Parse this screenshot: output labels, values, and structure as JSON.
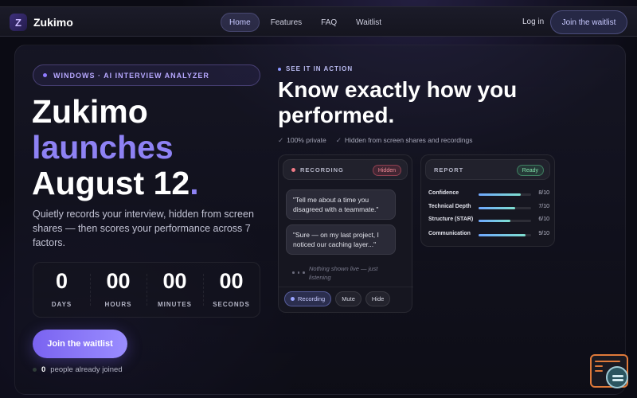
{
  "nav": {
    "logo_letter": "Z",
    "brand": "Zukimo",
    "links": [
      "Home",
      "Features",
      "FAQ",
      "Waitlist"
    ],
    "active_link": "Home",
    "login": "Log in",
    "cta": "Join the waitlist"
  },
  "hero": {
    "pill": "WINDOWS · AI INTERVIEW ANALYZER",
    "title_line1": "Zukimo",
    "title_line2": "launches",
    "title_line3": "August 12",
    "title_period": ".",
    "lede": "Quietly records your interview, hidden from screen shares — then scores your performance across 7 factors.",
    "countdown": [
      {
        "value": "0",
        "label": "DAYS"
      },
      {
        "value": "00",
        "label": "HOURS"
      },
      {
        "value": "00",
        "label": "MINUTES"
      },
      {
        "value": "00",
        "label": "SECONDS"
      }
    ],
    "cta": "Join the waitlist",
    "joined_count": "0",
    "joined_text": "people already joined"
  },
  "demo": {
    "eyebrow": "SEE IT IN ACTION",
    "title": "Know exactly how you performed.",
    "checks": [
      "100% private",
      "Hidden from screen shares and recordings"
    ],
    "recording": {
      "label": "RECORDING",
      "badge": "Hidden",
      "bubbles": [
        "\"Tell me about a time you disagreed with a teammate.\"",
        "\"Sure — on my last project, I noticed our caching layer...\""
      ],
      "status": "Nothing shown live — just listening",
      "controls": [
        "Recording",
        "Mute",
        "Hide"
      ]
    },
    "report": {
      "label": "REPORT",
      "badge": "Ready",
      "metrics": [
        {
          "name": "Confidence",
          "value": "8/10",
          "score": 0.8
        },
        {
          "name": "Technical Depth",
          "value": "7/10",
          "score": 0.7
        },
        {
          "name": "Structure (STAR)",
          "value": "6/10",
          "score": 0.6
        },
        {
          "name": "Communication",
          "value": "9/10",
          "score": 0.9
        }
      ]
    }
  },
  "colors": {
    "accent": "#8e82f4",
    "background": "#0b0b14",
    "recording_red": "#f07a86",
    "ready_green": "#7fe0a8"
  },
  "icons": [
    "logo-z-icon",
    "check-icon",
    "record-dot-icon",
    "feedback-widget-icon"
  ]
}
